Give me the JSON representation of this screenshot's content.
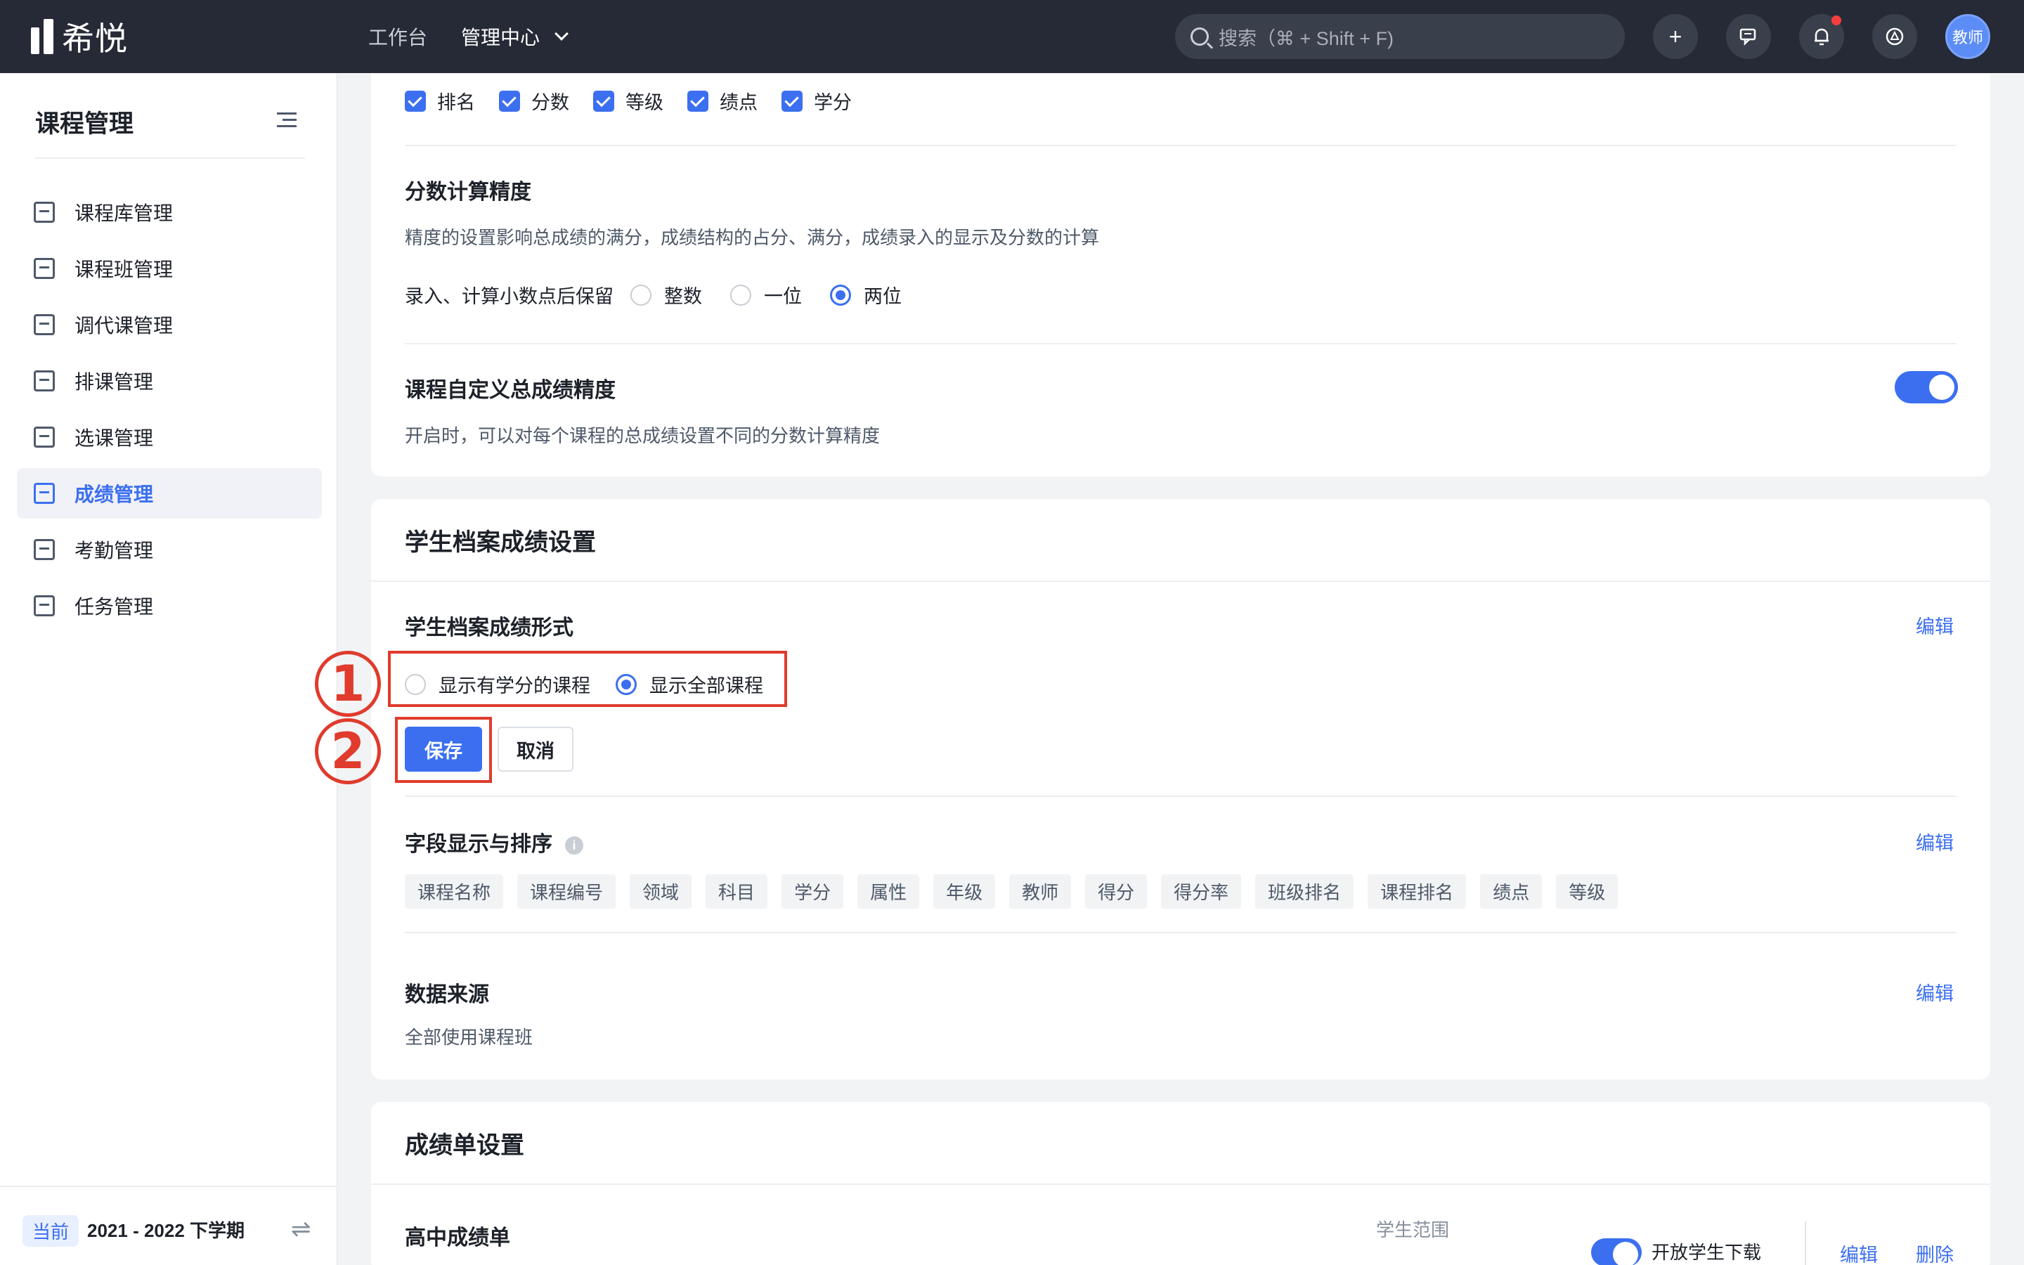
{
  "header": {
    "logo_text": "希悦",
    "nav": [
      {
        "label": "工作台"
      },
      {
        "label": "管理中心"
      }
    ],
    "search_placeholder": "搜索（⌘ + Shift + F)",
    "add_icon": "+",
    "avatar_label": "教师"
  },
  "sidebar": {
    "title": "课程管理",
    "items": [
      {
        "label": "课程库管理",
        "icon": "list-icon"
      },
      {
        "label": "课程班管理",
        "icon": "class-icon"
      },
      {
        "label": "调代课管理",
        "icon": "swap-icon"
      },
      {
        "label": "排课管理",
        "icon": "schedule-icon"
      },
      {
        "label": "选课管理",
        "icon": "check-icon"
      },
      {
        "label": "成绩管理",
        "icon": "grade-icon",
        "active": true
      },
      {
        "label": "考勤管理",
        "icon": "calendar-icon"
      },
      {
        "label": "任务管理",
        "icon": "task-icon"
      }
    ],
    "term_badge": "当前",
    "term": "2021 - 2022 下学期",
    "switch_icon": "⇌"
  },
  "card1": {
    "checkboxes": [
      "排名",
      "分数",
      "等级",
      "绩点",
      "学分"
    ],
    "precision_title": "分数计算精度",
    "precision_desc": "精度的设置影响总成绩的满分，成绩结构的占分、满分，成绩录入的显示及分数的计算",
    "decimal_label": "录入、计算小数点后保留",
    "decimal_options": [
      "整数",
      "一位",
      "两位"
    ],
    "decimal_selected": "两位",
    "custom_title": "课程自定义总成绩精度",
    "custom_desc": "开启时，可以对每个课程的总成绩设置不同的分数计算精度",
    "custom_enabled": true
  },
  "card2": {
    "title": "学生档案成绩设置",
    "form_title": "学生档案成绩形式",
    "edit": "编辑",
    "options": [
      "显示有学分的课程",
      "显示全部课程"
    ],
    "selected": "显示全部课程",
    "save": "保存",
    "cancel": "取消",
    "annot1": "1",
    "annot2": "2",
    "fields_title": "字段显示与排序",
    "info_icon": "i",
    "fields": [
      "课程名称",
      "课程编号",
      "领域",
      "科目",
      "学分",
      "属性",
      "年级",
      "教师",
      "得分",
      "得分率",
      "班级排名",
      "课程排名",
      "绩点",
      "等级"
    ],
    "source_title": "数据来源",
    "source_value": "全部使用课程班"
  },
  "card3": {
    "title": "成绩单设置",
    "item_title": "高中成绩单",
    "scope_label": "学生范围",
    "download_label": "开放学生下载",
    "download_enabled": true,
    "edit": "编辑",
    "delete": "删除"
  },
  "colors": {
    "accent": "#3c6ff0",
    "topbar": "#262a36",
    "annotation": "#e03b2c"
  }
}
